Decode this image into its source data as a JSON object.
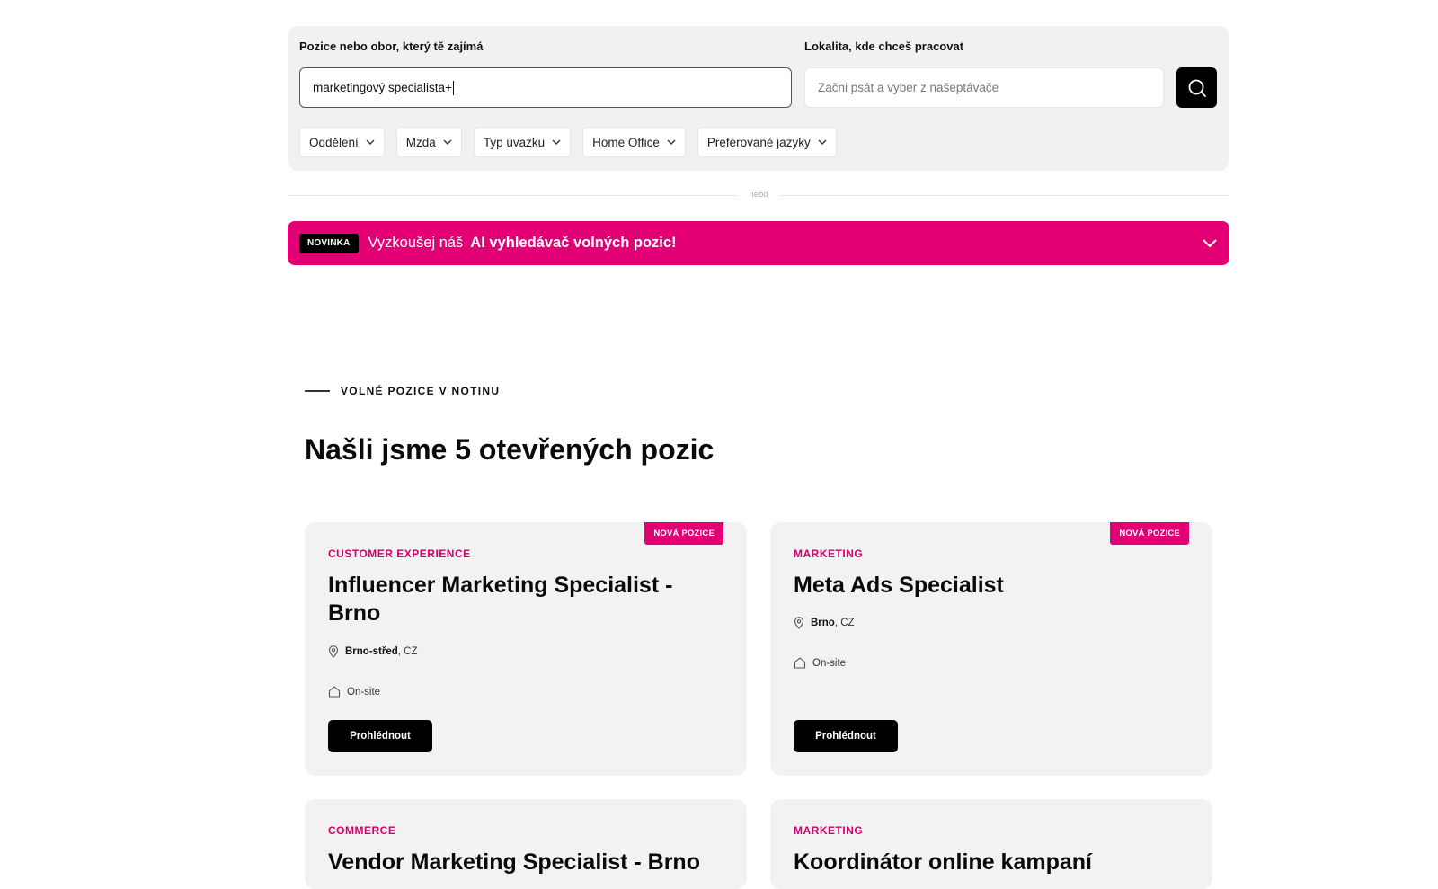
{
  "search": {
    "position_label": "Pozice nebo obor, který tě zajímá",
    "position_value": "marketingový specialista+",
    "location_label": "Lokalita, kde chceš pracovat",
    "location_placeholder": "Začni psát a vyber z našeptávače",
    "search_icon": "search-icon"
  },
  "filters": [
    {
      "label": "Oddělení"
    },
    {
      "label": "Mzda"
    },
    {
      "label": "Typ úvazku"
    },
    {
      "label": "Home Office"
    },
    {
      "label": "Preferované jazyky"
    }
  ],
  "divider_text": "nebo",
  "ai_banner": {
    "badge": "NOVINKA",
    "text": "Vyzkoušej náš",
    "text_strong": "AI vyhledávač volných pozic!",
    "color": "#e20074"
  },
  "section": {
    "eyebrow": "VOLNÉ POZICE V NOTINU",
    "title": "Našli jsme 5 otevřených pozic"
  },
  "jobs": [
    {
      "badge": "NOVÁ POZICE",
      "category": "CUSTOMER EXPERIENCE",
      "title": "Influencer Marketing Specialist - Brno",
      "city": "Brno-střed",
      "country": ", CZ",
      "workplace": "On-site",
      "button": "Prohlédnout"
    },
    {
      "badge": "NOVÁ POZICE",
      "category": "MARKETING",
      "title": "Meta Ads Specialist",
      "city": "Brno",
      "country": ", CZ",
      "workplace": "On-site",
      "button": "Prohlédnout"
    },
    {
      "category": "COMMERCE",
      "title": "Vendor Marketing Specialist - Brno"
    },
    {
      "category": "MARKETING",
      "title": "Koordinátor online kampaní"
    }
  ],
  "colors": {
    "accent": "#e20074",
    "category": "#d1006a",
    "panel": "#f1f1f1"
  }
}
